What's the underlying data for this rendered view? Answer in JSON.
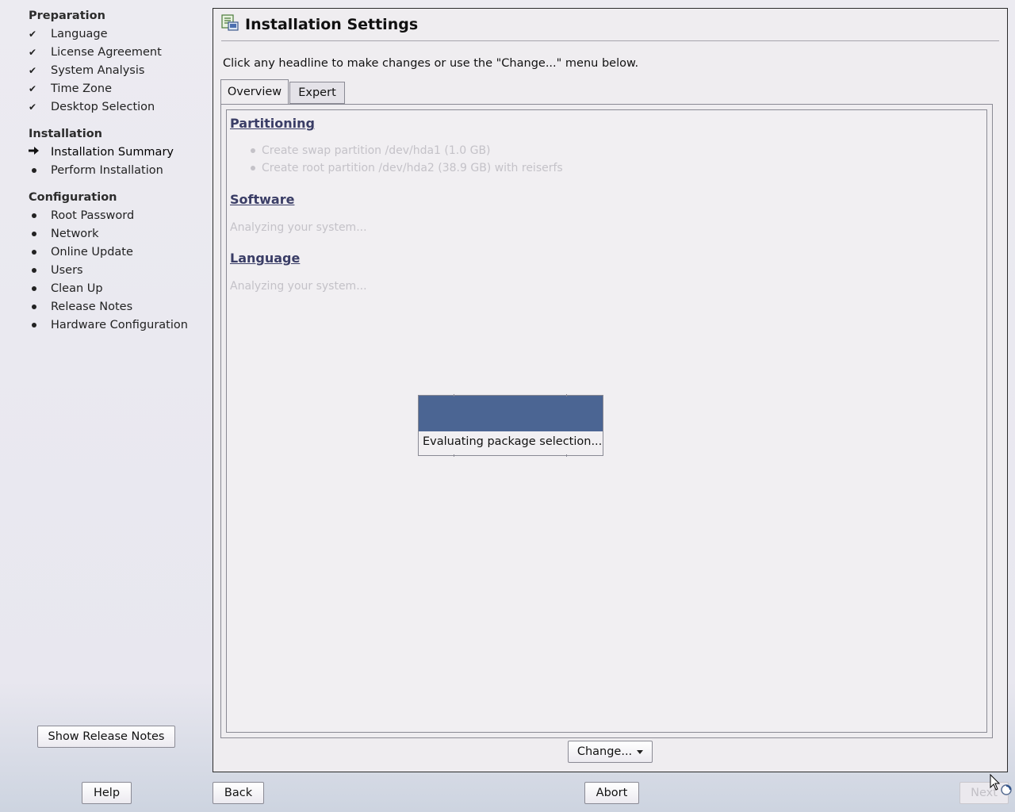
{
  "sidebar": {
    "sections": [
      {
        "title": "Preparation",
        "steps": [
          {
            "label": "Language",
            "state": "done"
          },
          {
            "label": "License Agreement",
            "state": "done"
          },
          {
            "label": "System Analysis",
            "state": "done"
          },
          {
            "label": "Time Zone",
            "state": "done"
          },
          {
            "label": "Desktop Selection",
            "state": "done"
          }
        ]
      },
      {
        "title": "Installation",
        "steps": [
          {
            "label": "Installation Summary",
            "state": "current"
          },
          {
            "label": "Perform Installation",
            "state": "pending"
          }
        ]
      },
      {
        "title": "Configuration",
        "steps": [
          {
            "label": "Root Password",
            "state": "pending"
          },
          {
            "label": "Network",
            "state": "pending"
          },
          {
            "label": "Online Update",
            "state": "pending"
          },
          {
            "label": "Users",
            "state": "pending"
          },
          {
            "label": "Clean Up",
            "state": "pending"
          },
          {
            "label": "Release Notes",
            "state": "pending"
          },
          {
            "label": "Hardware Configuration",
            "state": "pending"
          }
        ]
      }
    ],
    "show_release_notes_label": "Show Release Notes"
  },
  "main": {
    "title": "Installation Settings",
    "instruction": "Click any headline to make changes or use the \"Change...\" menu below.",
    "tabs": [
      {
        "label": "Overview",
        "active": true
      },
      {
        "label": "Expert",
        "active": false
      }
    ],
    "overview": {
      "partitioning": {
        "headline": "Partitioning",
        "items": [
          "Create swap partition /dev/hda1 (1.0 GB)",
          "Create root partition /dev/hda2 (38.9 GB) with reiserfs"
        ]
      },
      "software": {
        "headline": "Software",
        "status": "Analyzing your system..."
      },
      "language": {
        "headline": "Language",
        "status": "Analyzing your system..."
      }
    },
    "progress_popup": {
      "text": "Evaluating package selection..."
    },
    "change_label": "Change..."
  },
  "footer": {
    "help_label": "Help",
    "back_label": "Back",
    "abort_label": "Abort",
    "next_label": "Next"
  },
  "colors": {
    "headline": "#3a3d66",
    "popup_bar": "#4b6593",
    "disabled_text": "#c4c2c8"
  }
}
